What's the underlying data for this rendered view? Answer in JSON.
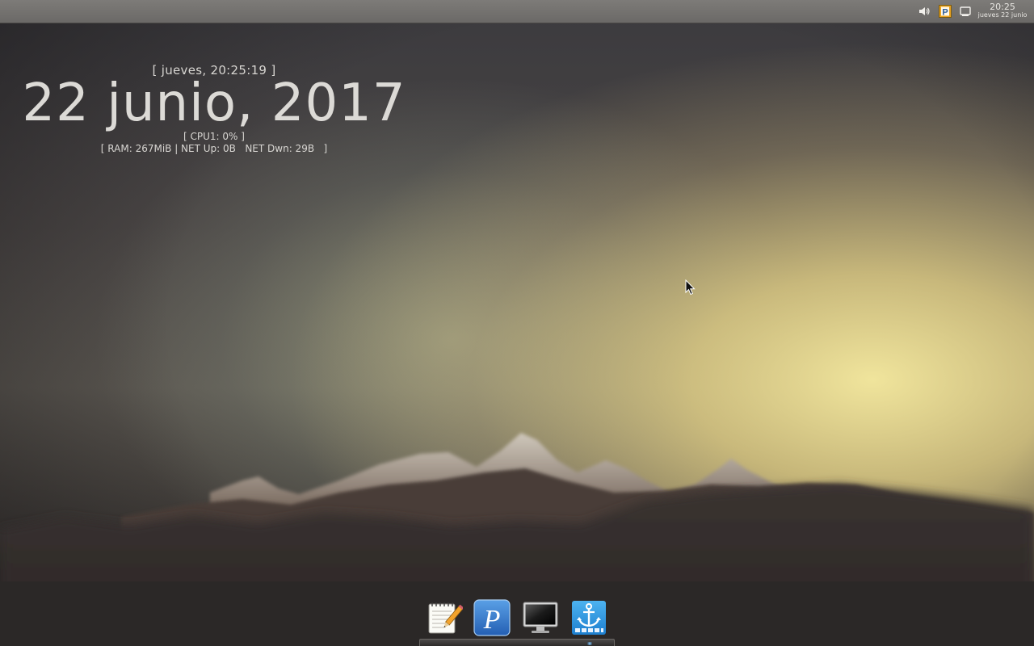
{
  "top_panel": {
    "clock_time": "20:25",
    "clock_date": "jueves 22 junio",
    "tray_icons": [
      "volume-icon",
      "p-app-icon",
      "window-icon"
    ]
  },
  "conky": {
    "day_line": "[ jueves, 20:25:19 ]",
    "date_line": "22 junio, 2017",
    "cpu_line": "[ CPU1: 0% ]",
    "stats_line": "[ RAM: 267MiB | NET Up: 0B   NET Dwn: 29B   ]"
  },
  "dock": {
    "items": [
      "text-editor-icon",
      "p-app-icon",
      "monitor-icon",
      "anchor-icon"
    ],
    "active_item": "anchor-icon"
  },
  "colors": {
    "panel": "#75736f",
    "sky_glow": "#f0e496",
    "text": "#d8d6d2"
  }
}
